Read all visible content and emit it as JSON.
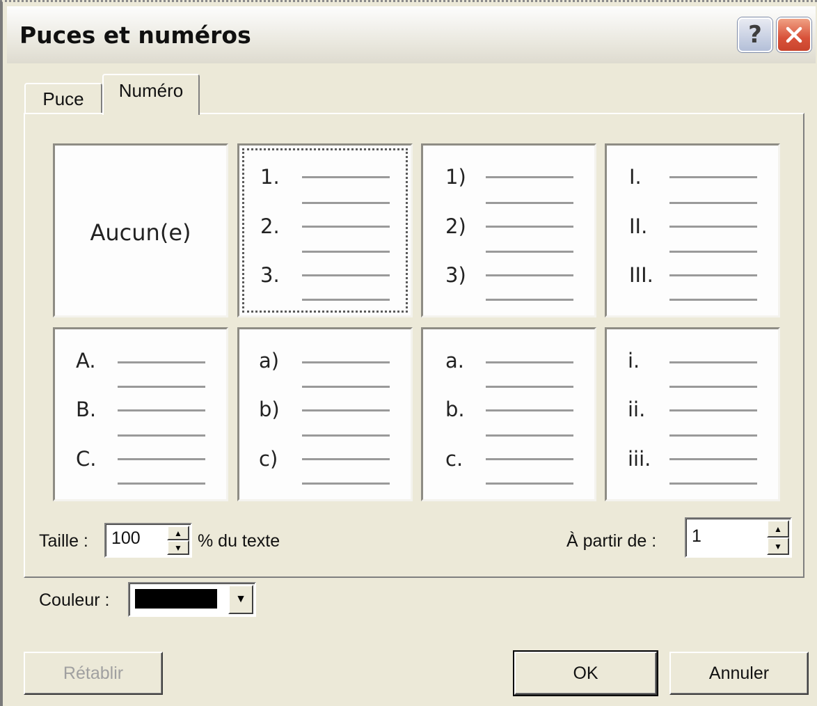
{
  "window": {
    "title": "Puces et numéros",
    "help_label": "?",
    "close_label": "✕"
  },
  "tabs": [
    {
      "label": "Puce",
      "active": false
    },
    {
      "label": "Numéro",
      "active": true
    }
  ],
  "styles": [
    {
      "id": "none",
      "label": "Aucun(e)"
    },
    {
      "id": "decimal-dot",
      "markers": [
        "1.",
        "2.",
        "3."
      ],
      "selected": true
    },
    {
      "id": "decimal-paren",
      "markers": [
        "1)",
        "2)",
        "3)"
      ]
    },
    {
      "id": "upper-roman",
      "markers": [
        "I.",
        "II.",
        "III."
      ]
    },
    {
      "id": "upper-alpha",
      "markers": [
        "A.",
        "B.",
        "C."
      ]
    },
    {
      "id": "lower-alpha-paren",
      "markers": [
        "a)",
        "b)",
        "c)"
      ]
    },
    {
      "id": "lower-alpha-dot",
      "markers": [
        "a.",
        "b.",
        "c."
      ]
    },
    {
      "id": "lower-roman",
      "markers": [
        "i.",
        "ii.",
        "iii."
      ]
    }
  ],
  "size": {
    "label": "Taille :",
    "value": "100",
    "suffix": "% du texte"
  },
  "start_at": {
    "label": "À partir de :",
    "value": "1"
  },
  "color": {
    "label": "Couleur :",
    "value": "#000000"
  },
  "buttons": {
    "reset": "Rétablir",
    "ok": "OK",
    "cancel": "Annuler"
  }
}
